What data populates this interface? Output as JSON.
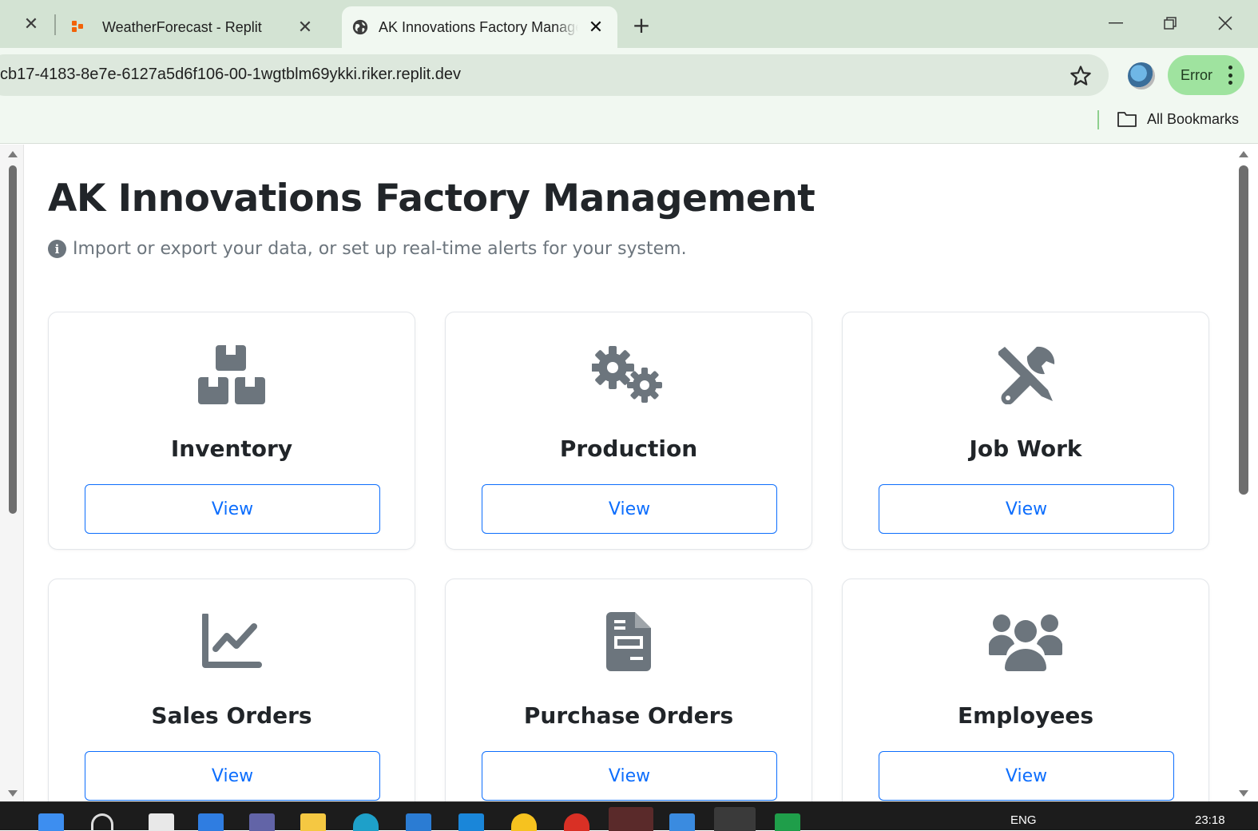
{
  "browser": {
    "tabs": [
      {
        "title": "WeatherForecast - Replit",
        "active": false
      },
      {
        "title": "AK Innovations Factory Management",
        "active": true
      }
    ],
    "url": "cb17-4183-8e7e-6127a5d6f106-00-1wgtblm69ykki.riker.replit.dev",
    "profile_status": "Error",
    "bookmarks_folder": "All Bookmarks"
  },
  "page": {
    "title": "AK Innovations Factory Management",
    "subtitle": "Import or export your data, or set up real-time alerts for your system.",
    "cards": [
      {
        "label": "Inventory",
        "button": "View",
        "icon": "boxes-icon"
      },
      {
        "label": "Production",
        "button": "View",
        "icon": "gears-icon"
      },
      {
        "label": "Job Work",
        "button": "View",
        "icon": "tools-icon"
      },
      {
        "label": "Sales Orders",
        "button": "View",
        "icon": "chart-line-icon"
      },
      {
        "label": "Purchase Orders",
        "button": "View",
        "icon": "file-invoice-icon"
      },
      {
        "label": "Employees",
        "button": "View",
        "icon": "users-icon"
      }
    ]
  },
  "taskbar": {
    "language": "ENG",
    "time": "23:18"
  },
  "colors": {
    "accent": "#0d6efd",
    "icon_gray": "#6c757d",
    "tabstrip": "#d3e3d3",
    "error_pill": "#9fe39f"
  }
}
